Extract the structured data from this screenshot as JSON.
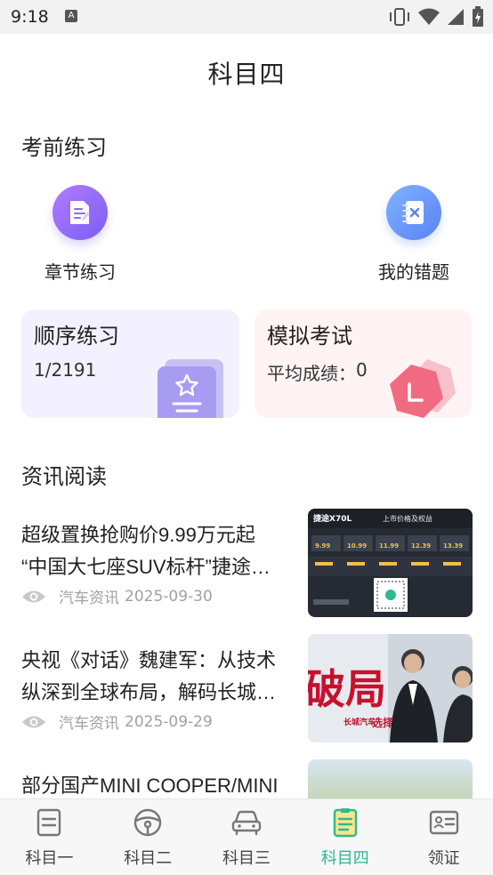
{
  "status_bar": {
    "time": "9:18",
    "notification_letter": "A",
    "icons": [
      "vibrate-icon",
      "wifi-icon",
      "cellular-icon",
      "battery-icon"
    ]
  },
  "page": {
    "title": "科目四"
  },
  "practice": {
    "section_title": "考前练习",
    "shortcuts": [
      {
        "label": "章节练习",
        "icon": "chapter-doc-icon",
        "color": "#8b6cf6"
      },
      {
        "label": "我的错题",
        "icon": "wrong-notebook-icon",
        "color": "#6a90f7"
      }
    ],
    "cards": [
      {
        "title": "顺序练习",
        "progress_text": "1/2191",
        "icon": "star-card-icon",
        "color": "#a89cf2"
      },
      {
        "title": "模拟考试",
        "score_label": "平均成绩：",
        "score_value": "0",
        "icon": "exam-hexagon-icon",
        "color": "#f06a82"
      }
    ]
  },
  "news": {
    "section_title": "资讯阅读",
    "items": [
      {
        "line1": "超级置换抢购价9.99万元起",
        "line2": "“中国大七座SUV标杆”捷途…",
        "source": "汽车资讯",
        "date": "2025-09-30",
        "thumb": {
          "brand": "捷途X70L",
          "headline": "上市价格及权益",
          "prices": [
            "9.99",
            "10.99",
            "11.99",
            "12.39",
            "13.39"
          ]
        }
      },
      {
        "line1": "央视《对话》魏建军：从技术",
        "line2": "纵深到全球布局，解码长城…",
        "source": "汽车资讯",
        "date": "2025-09-29",
        "thumb": {
          "big_text": "破局",
          "brand": "长城汽车",
          "choice_text": "选择"
        }
      },
      {
        "line1": "部分国产MINI COOPER/MINI",
        "line2": "",
        "source": "",
        "date": ""
      }
    ]
  },
  "bottom_nav": {
    "items": [
      {
        "label": "科目一",
        "icon": "subject-one-doc-icon",
        "active": false
      },
      {
        "label": "科目二",
        "icon": "steering-wheel-icon",
        "active": false
      },
      {
        "label": "科目三",
        "icon": "car-icon",
        "active": false
      },
      {
        "label": "科目四",
        "icon": "subject-four-notebook-icon",
        "active": true
      },
      {
        "label": "领证",
        "icon": "license-card-icon",
        "active": false
      }
    ],
    "active_color": "#2fb98e",
    "inactive_color": "#777777"
  }
}
